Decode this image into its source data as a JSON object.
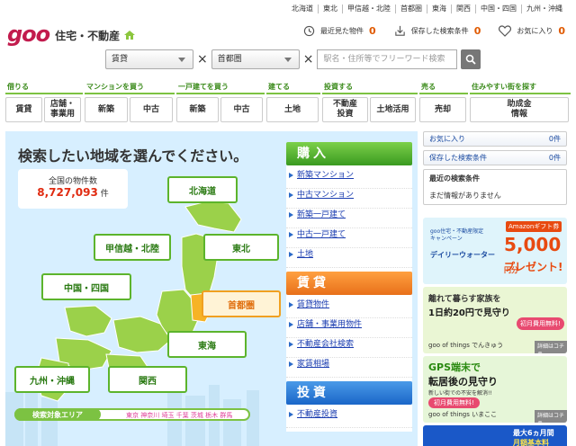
{
  "top_regions": [
    "北海道",
    "東北",
    "甲信越・北陸",
    "首都圏",
    "東海",
    "関西",
    "中国・四国",
    "九州・沖縄"
  ],
  "logo": {
    "brand": "goo",
    "site": "住宅・不動産"
  },
  "header": {
    "recent_label": "最近見た物件",
    "recent_count": "0",
    "saved_label": "保存した検索条件",
    "saved_count": "0",
    "fav_label": "お気に入り",
    "fav_count": "0"
  },
  "search": {
    "type_value": "賃貸",
    "area_value": "首都圏",
    "placeholder": "駅名・住所等でフリーワード検索",
    "x1": "×",
    "x2": "×"
  },
  "categories": [
    {
      "label": "借りる",
      "buttons": [
        "賃貸",
        "店舗・\n事業用"
      ]
    },
    {
      "label": "マンションを買う",
      "buttons": [
        "新築",
        "中古"
      ]
    },
    {
      "label": "一戸建てを買う",
      "buttons": [
        "新築",
        "中古"
      ]
    },
    {
      "label": "建てる",
      "buttons": [
        "土地"
      ]
    },
    {
      "label": "投資する",
      "buttons": [
        "不動産\n投資",
        "土地活用"
      ]
    },
    {
      "label": "売る",
      "buttons": [
        "売却"
      ]
    },
    {
      "label": "住みやすい街を探す",
      "buttons": [
        "助成金\n情報"
      ]
    }
  ],
  "map": {
    "title": "検索したい地域を選んでください。",
    "count_label": "全国の物件数",
    "count_value": "8,727,093",
    "count_unit": "件",
    "regions": {
      "hokkaido": "北海道",
      "koshinetsu": "甲信越・北陸",
      "tohoku": "東北",
      "chugoku": "中国・四国",
      "shutoken": "首都圏",
      "tokai": "東海",
      "kyushu": "九州・沖縄",
      "kansai": "関西"
    },
    "area_label": "検索対象エリア",
    "area_prefs": "東京 神奈川 埼玉 千葉 茨城 栃木 群馬"
  },
  "buy": {
    "title": "購入",
    "links": [
      "新築マンション",
      "中古マンション",
      "新築一戸建て",
      "中古一戸建て",
      "土地"
    ]
  },
  "rent": {
    "title": "賃貸",
    "links": [
      "賃貸物件",
      "店舗・事業用物件",
      "不動産会社検索",
      "家賃相場"
    ]
  },
  "invest": {
    "title": "投資",
    "links": [
      "不動産投資"
    ]
  },
  "right": {
    "fav_label": "お気に入り",
    "fav_count": "0件",
    "saved_label": "保存した検索条件",
    "saved_count": "0件",
    "recent_title": "最近の検索条件",
    "recent_empty": "まだ情報がありません"
  },
  "ads": {
    "ad1_sub": "goo住宅・不動産限定キャンペーン",
    "ad1_brand": "デイリーウォーター",
    "ad1_gift": "Amazonギフト券",
    "ad1_amount": "5,000",
    "ad1_unit": "円分",
    "ad1_cta": "プレゼント!",
    "ad2_line1": "離れて暮らす家族を",
    "ad2_line2": "1日約20円で見守り",
    "ad2_badge": "初月費用無料!",
    "ad2_brand": "goo of things でんきゅう",
    "ad2_more": "詳細はコチラ",
    "ad3_line1": "GPS端末で",
    "ad3_line2": "転居後の見守り",
    "ad3_line3": "新しい街での不安を解消!!",
    "ad3_badge": "初月費用無料!",
    "ad3_brand": "goo of things いまここ",
    "ad3_more": "詳細はコチラ",
    "ad4_line1": "最大6ヵ月間",
    "ad4_line2": "月額基本料"
  },
  "colors": {
    "brand": "#c21b4d",
    "accent_green": "#5cb42c",
    "rent_orange": "#e8701a",
    "invest_blue": "#1a66c8",
    "count_red": "#e02a10"
  }
}
